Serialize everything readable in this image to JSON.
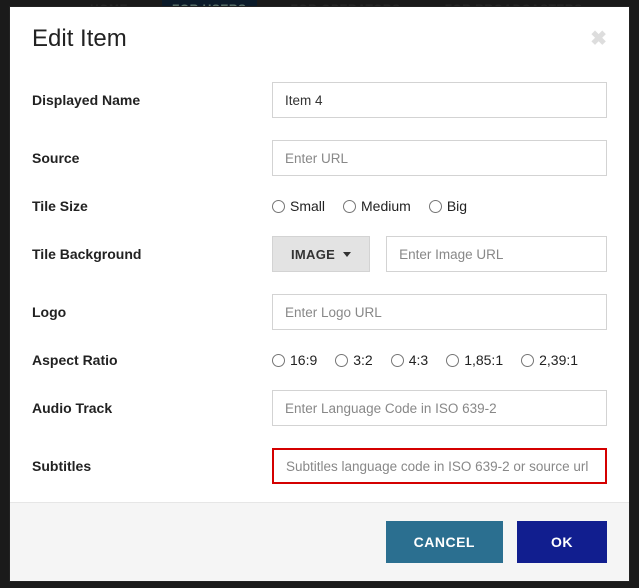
{
  "nav": {
    "home": "HOME",
    "users": "FOR USERS",
    "operators": "FOR OPERATORS",
    "broadcasters": "FOR BROADCASTERS"
  },
  "modal": {
    "title": "Edit Item",
    "labels": {
      "displayedName": "Displayed Name",
      "source": "Source",
      "tileSize": "Tile Size",
      "tileBackground": "Tile Background",
      "logo": "Logo",
      "aspectRatio": "Aspect Ratio",
      "audioTrack": "Audio Track",
      "subtitles": "Subtitles"
    },
    "values": {
      "displayedName": "Item 4"
    },
    "placeholders": {
      "source": "Enter URL",
      "imageUrl": "Enter Image URL",
      "logo": "Enter Logo URL",
      "audioTrack": "Enter Language Code in ISO 639-2",
      "subtitles": "Subtitles language code in ISO 639-2 or source url"
    },
    "tileSizes": {
      "small": "Small",
      "medium": "Medium",
      "big": "Big"
    },
    "bgType": "IMAGE",
    "aspectRatios": {
      "r169": "16:9",
      "r32": "3:2",
      "r43": "4:3",
      "r1851": "1,85:1",
      "r2391": "2,39:1"
    },
    "buttons": {
      "cancel": "CANCEL",
      "ok": "OK"
    }
  }
}
